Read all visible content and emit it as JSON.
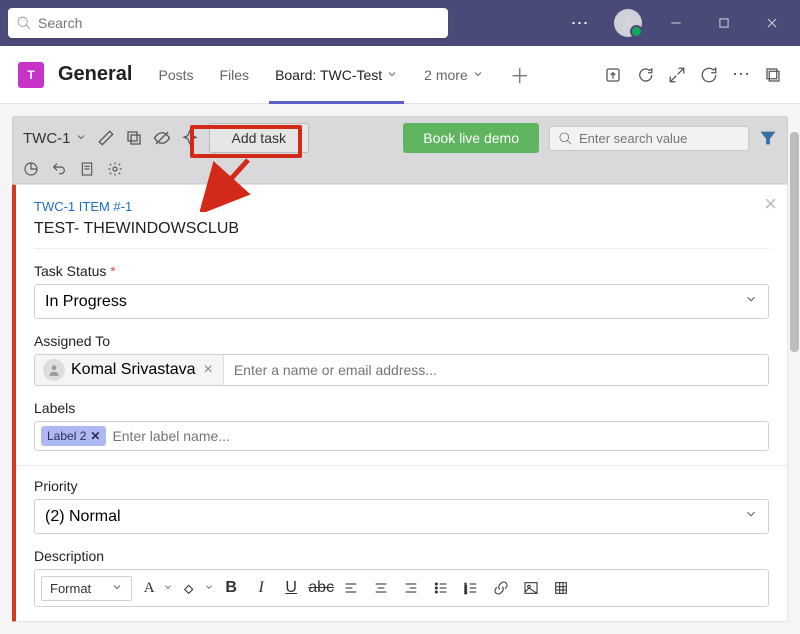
{
  "titlebar": {
    "search_placeholder": "Search"
  },
  "channel": {
    "team_initial": "T",
    "name": "General",
    "tabs": {
      "posts": "Posts",
      "files": "Files",
      "board": "Board: TWC-Test",
      "more": "2 more"
    }
  },
  "board": {
    "name": "TWC-1",
    "add_task_label": "Add task",
    "demo_label": "Book live demo",
    "search_placeholder": "Enter search value"
  },
  "task": {
    "item_id": "TWC-1 ITEM #-1",
    "title": "TEST- THEWINDOWSCLUB",
    "status_label": "Task Status",
    "status_value": "In Progress",
    "assigned_label": "Assigned To",
    "assigned_person": "Komal Srivastava",
    "assigned_placeholder": "Enter a name or email address...",
    "labels_label": "Labels",
    "label_chip": "Label 2",
    "labels_placeholder": "Enter label name...",
    "priority_label": "Priority",
    "priority_value": "(2) Normal",
    "description_label": "Description",
    "format_label": "Format"
  }
}
